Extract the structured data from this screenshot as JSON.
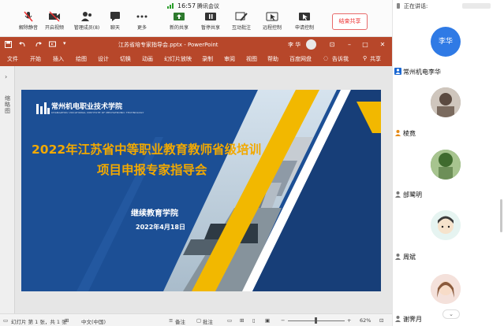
{
  "meeting": {
    "time": "16:57",
    "app_title": "腾讯会议",
    "toolbar": [
      {
        "label": "解除静音",
        "icon": "mic-muted-icon"
      },
      {
        "label": "开启视频",
        "icon": "video-off-icon"
      },
      {
        "label": "管理成员(8)",
        "icon": "members-icon"
      },
      {
        "label": "聊天",
        "icon": "chat-icon"
      },
      {
        "label": "更多",
        "icon": "more-icon"
      },
      {
        "label": "新的共享",
        "icon": "share-icon"
      },
      {
        "label": "暂停共享",
        "icon": "pause-icon"
      },
      {
        "label": "互动批注",
        "icon": "annotate-icon"
      },
      {
        "label": "远程控制",
        "icon": "remote-control-icon"
      },
      {
        "label": "申请控制",
        "icon": "request-control-icon"
      }
    ],
    "end_share": "结束共享",
    "accent": "#e33333"
  },
  "ppt": {
    "doc_title": "江苏省培专家指导会.pptx  -  PowerPoint",
    "user": "李 华",
    "accent": "#b7472a",
    "tabs": [
      "文件",
      "开始",
      "插入",
      "绘图",
      "设计",
      "切换",
      "动画",
      "幻灯片放映",
      "录制",
      "审阅",
      "视图",
      "帮助",
      "百度网盘"
    ],
    "tell_me": "告诉我",
    "share": "共享",
    "thumb_label": "缩略图",
    "status": {
      "slide_info": "幻灯片 第 1 张，共 1 张",
      "language": "中文(中国)",
      "notes": "备注",
      "comments": "批注",
      "zoom": "62%"
    }
  },
  "slide": {
    "school_name": "常州机电职业技术学院",
    "school_name_en": "CHANGZHOU VOCATIONAL INSTITUTE OF MECHATRONIC TECHNOLOGY",
    "title_line1": "2022年江苏省中等职业教育教师省级培训",
    "title_line2": "项目申报专家指导会",
    "organizer": "继续教育学院",
    "date": "2022年4月18日",
    "bg_color": "#1c4f95",
    "title_color": "#f2a900"
  },
  "panel": {
    "speaking_label": "正在讲话:",
    "participants": [
      {
        "name": "李华",
        "initials": "李华",
        "host": true
      },
      {
        "name": "常州机电李华",
        "host": true
      },
      {
        "name": "棱竟"
      },
      {
        "name": "邰鹭明"
      },
      {
        "name": "周斌"
      },
      {
        "name": "谢霁月"
      }
    ]
  }
}
